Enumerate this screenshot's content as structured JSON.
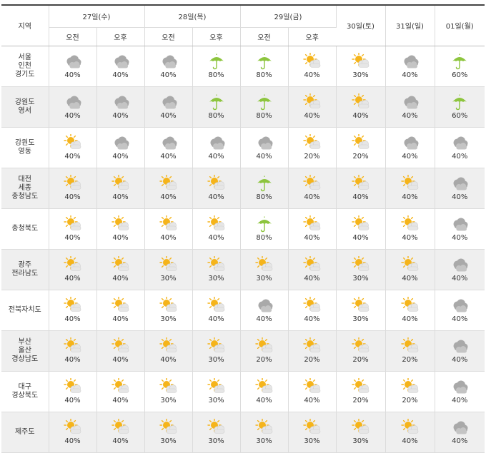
{
  "header": {
    "region_label": "지역",
    "days": [
      {
        "label": "27일(수)",
        "split": true
      },
      {
        "label": "28일(목)",
        "split": true
      },
      {
        "label": "29일(금)",
        "split": true
      },
      {
        "label": "30일(토)",
        "split": false
      },
      {
        "label": "31일(일)",
        "split": false
      },
      {
        "label": "01일(월)",
        "split": false
      }
    ],
    "am_label": "오전",
    "pm_label": "오후"
  },
  "rows": [
    {
      "region": "서울\n인천\n경기도",
      "cells": [
        {
          "icon": "cloudy-icon",
          "pct": "40%"
        },
        {
          "icon": "cloudy-icon",
          "pct": "40%"
        },
        {
          "icon": "cloudy-icon",
          "pct": "40%"
        },
        {
          "icon": "umbrella-icon",
          "pct": "80%"
        },
        {
          "icon": "umbrella-icon",
          "pct": "80%"
        },
        {
          "icon": "partly-cloudy-icon",
          "pct": "40%"
        },
        {
          "icon": "partly-cloudy-icon",
          "pct": "30%"
        },
        {
          "icon": "cloudy-icon",
          "pct": "40%"
        },
        {
          "icon": "umbrella-icon",
          "pct": "60%"
        }
      ]
    },
    {
      "region": "강원도\n영서",
      "cells": [
        {
          "icon": "cloudy-icon",
          "pct": "40%"
        },
        {
          "icon": "cloudy-icon",
          "pct": "40%"
        },
        {
          "icon": "cloudy-icon",
          "pct": "40%"
        },
        {
          "icon": "umbrella-icon",
          "pct": "80%"
        },
        {
          "icon": "umbrella-icon",
          "pct": "80%"
        },
        {
          "icon": "partly-cloudy-icon",
          "pct": "40%"
        },
        {
          "icon": "partly-cloudy-icon",
          "pct": "40%"
        },
        {
          "icon": "cloudy-icon",
          "pct": "40%"
        },
        {
          "icon": "umbrella-icon",
          "pct": "60%"
        }
      ]
    },
    {
      "region": "강원도\n영동",
      "cells": [
        {
          "icon": "partly-cloudy-icon",
          "pct": "40%"
        },
        {
          "icon": "cloudy-icon",
          "pct": "40%"
        },
        {
          "icon": "cloudy-icon",
          "pct": "40%"
        },
        {
          "icon": "cloudy-icon",
          "pct": "40%"
        },
        {
          "icon": "cloudy-icon",
          "pct": "40%"
        },
        {
          "icon": "partly-cloudy-icon",
          "pct": "20%"
        },
        {
          "icon": "partly-cloudy-icon",
          "pct": "20%"
        },
        {
          "icon": "cloudy-icon",
          "pct": "40%"
        },
        {
          "icon": "cloudy-icon",
          "pct": "40%"
        }
      ]
    },
    {
      "region": "대전\n세종\n충청남도",
      "cells": [
        {
          "icon": "partly-cloudy-icon",
          "pct": "40%"
        },
        {
          "icon": "partly-cloudy-icon",
          "pct": "40%"
        },
        {
          "icon": "partly-cloudy-icon",
          "pct": "40%"
        },
        {
          "icon": "partly-cloudy-icon",
          "pct": "40%"
        },
        {
          "icon": "umbrella-icon",
          "pct": "80%"
        },
        {
          "icon": "partly-cloudy-icon",
          "pct": "40%"
        },
        {
          "icon": "partly-cloudy-icon",
          "pct": "40%"
        },
        {
          "icon": "partly-cloudy-icon",
          "pct": "40%"
        },
        {
          "icon": "cloudy-icon",
          "pct": "40%"
        }
      ]
    },
    {
      "region": "충청북도",
      "cells": [
        {
          "icon": "partly-cloudy-icon",
          "pct": "40%"
        },
        {
          "icon": "partly-cloudy-icon",
          "pct": "40%"
        },
        {
          "icon": "partly-cloudy-icon",
          "pct": "40%"
        },
        {
          "icon": "partly-cloudy-icon",
          "pct": "40%"
        },
        {
          "icon": "umbrella-icon",
          "pct": "80%"
        },
        {
          "icon": "partly-cloudy-icon",
          "pct": "40%"
        },
        {
          "icon": "partly-cloudy-icon",
          "pct": "40%"
        },
        {
          "icon": "partly-cloudy-icon",
          "pct": "40%"
        },
        {
          "icon": "cloudy-icon",
          "pct": "40%"
        }
      ]
    },
    {
      "region": "광주\n전라남도",
      "cells": [
        {
          "icon": "partly-cloudy-icon",
          "pct": "40%"
        },
        {
          "icon": "partly-cloudy-icon",
          "pct": "40%"
        },
        {
          "icon": "partly-cloudy-icon",
          "pct": "30%"
        },
        {
          "icon": "partly-cloudy-icon",
          "pct": "30%"
        },
        {
          "icon": "partly-cloudy-icon",
          "pct": "30%"
        },
        {
          "icon": "partly-cloudy-icon",
          "pct": "40%"
        },
        {
          "icon": "partly-cloudy-icon",
          "pct": "30%"
        },
        {
          "icon": "partly-cloudy-icon",
          "pct": "40%"
        },
        {
          "icon": "cloudy-icon",
          "pct": "40%"
        }
      ]
    },
    {
      "region": "전북자치도",
      "cells": [
        {
          "icon": "partly-cloudy-icon",
          "pct": "40%"
        },
        {
          "icon": "partly-cloudy-icon",
          "pct": "40%"
        },
        {
          "icon": "partly-cloudy-icon",
          "pct": "30%"
        },
        {
          "icon": "partly-cloudy-icon",
          "pct": "40%"
        },
        {
          "icon": "cloudy-icon",
          "pct": "40%"
        },
        {
          "icon": "partly-cloudy-icon",
          "pct": "40%"
        },
        {
          "icon": "partly-cloudy-icon",
          "pct": "30%"
        },
        {
          "icon": "partly-cloudy-icon",
          "pct": "40%"
        },
        {
          "icon": "cloudy-icon",
          "pct": "40%"
        }
      ]
    },
    {
      "region": "부산\n울산\n경상남도",
      "cells": [
        {
          "icon": "partly-cloudy-icon",
          "pct": "40%"
        },
        {
          "icon": "partly-cloudy-icon",
          "pct": "40%"
        },
        {
          "icon": "partly-cloudy-icon",
          "pct": "40%"
        },
        {
          "icon": "partly-cloudy-icon",
          "pct": "30%"
        },
        {
          "icon": "partly-cloudy-icon",
          "pct": "20%"
        },
        {
          "icon": "partly-cloudy-icon",
          "pct": "20%"
        },
        {
          "icon": "partly-cloudy-icon",
          "pct": "20%"
        },
        {
          "icon": "partly-cloudy-icon",
          "pct": "20%"
        },
        {
          "icon": "cloudy-icon",
          "pct": "40%"
        }
      ]
    },
    {
      "region": "대구\n경상북도",
      "cells": [
        {
          "icon": "partly-cloudy-icon",
          "pct": "40%"
        },
        {
          "icon": "partly-cloudy-icon",
          "pct": "40%"
        },
        {
          "icon": "partly-cloudy-icon",
          "pct": "30%"
        },
        {
          "icon": "partly-cloudy-icon",
          "pct": "30%"
        },
        {
          "icon": "partly-cloudy-icon",
          "pct": "40%"
        },
        {
          "icon": "partly-cloudy-icon",
          "pct": "40%"
        },
        {
          "icon": "partly-cloudy-icon",
          "pct": "20%"
        },
        {
          "icon": "partly-cloudy-icon",
          "pct": "20%"
        },
        {
          "icon": "cloudy-icon",
          "pct": "40%"
        }
      ]
    },
    {
      "region": "제주도",
      "cells": [
        {
          "icon": "partly-cloudy-icon",
          "pct": "40%"
        },
        {
          "icon": "partly-cloudy-icon",
          "pct": "40%"
        },
        {
          "icon": "partly-cloudy-icon",
          "pct": "30%"
        },
        {
          "icon": "partly-cloudy-icon",
          "pct": "30%"
        },
        {
          "icon": "partly-cloudy-icon",
          "pct": "30%"
        },
        {
          "icon": "partly-cloudy-icon",
          "pct": "30%"
        },
        {
          "icon": "partly-cloudy-icon",
          "pct": "30%"
        },
        {
          "icon": "partly-cloudy-icon",
          "pct": "40%"
        },
        {
          "icon": "cloudy-icon",
          "pct": "40%"
        }
      ]
    }
  ],
  "colors": {
    "header_rule": "#444444",
    "grid": "#dcdcdc",
    "alt_row": "#efefef",
    "cloud": "#a9a9a9",
    "sun": "#f5b41a",
    "umbrella": "#8dc53e"
  }
}
